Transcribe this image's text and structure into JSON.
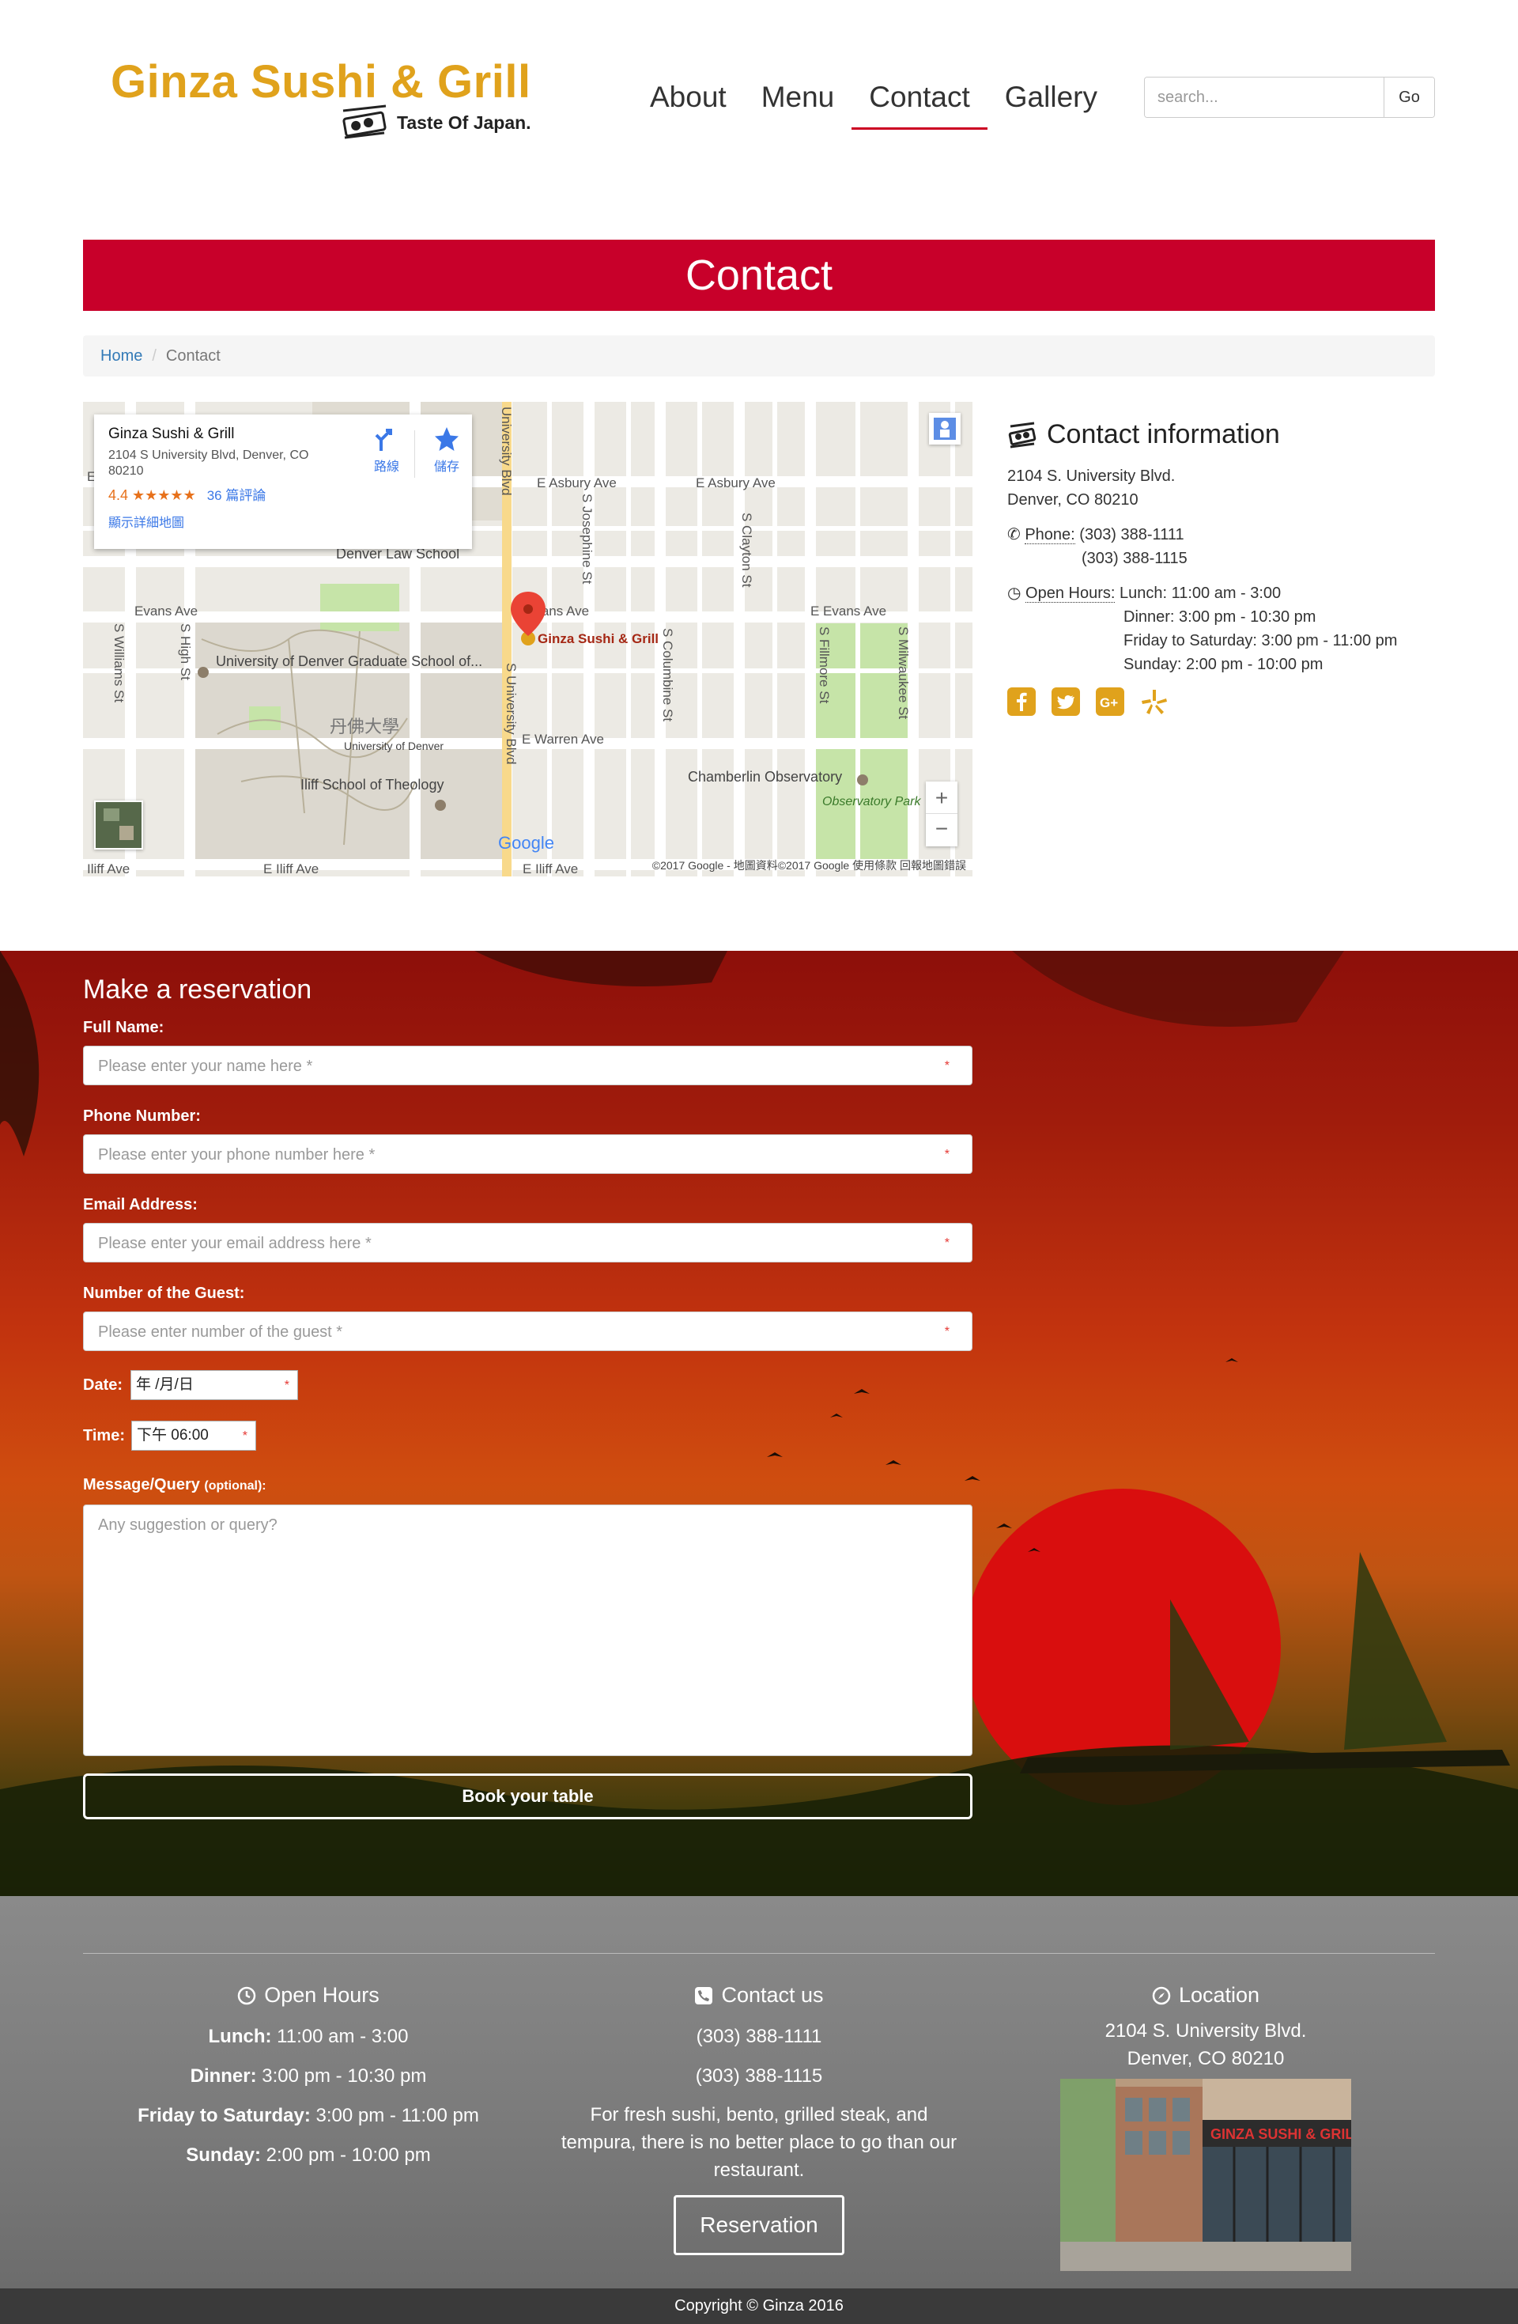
{
  "logo": {
    "title": "Ginza Sushi & Grill",
    "tagline": "Taste Of Japan."
  },
  "nav": [
    {
      "label": "About",
      "active": false
    },
    {
      "label": "Menu",
      "active": false
    },
    {
      "label": "Contact",
      "active": true
    },
    {
      "label": "Gallery",
      "active": false
    }
  ],
  "search": {
    "placeholder": "search...",
    "button": "Go"
  },
  "page_title": "Contact",
  "breadcrumb": {
    "home": "Home",
    "current": "Contact"
  },
  "map": {
    "card_name": "Ginza Sushi & Grill",
    "card_address": "2104 S University Blvd, Denver, CO 80210",
    "rating": "4.4 ★★★★★",
    "reviews": "36 篇評論",
    "more_link": "顯示詳細地圖",
    "directions": "路線",
    "save": "儲存",
    "pin_label": "Ginza Sushi & Grill",
    "streets": {
      "asbury_1": "E Asbury Ave",
      "asbury_2": "E Asbury Ave",
      "evans_1": "Evans Ave",
      "evans_2": "Evans Ave",
      "evans_3": "E Evans Ave",
      "warren": "E Warren Ave",
      "iliff_1": "Iliff Ave",
      "iliff_2": "E Iliff Ave",
      "iliff_3": "E Iliff Ave",
      "university": "S University Blvd",
      "university_top": "University Blvd",
      "josephine": "S Josephine St",
      "clayton": "S Clayton St",
      "columbine": "S Columbine St",
      "fillmore": "S Fillmore St",
      "milwaukee": "S Milwaukee St",
      "williams": "S Williams St",
      "high": "S High St"
    },
    "places": {
      "law_school": "Denver Law School",
      "grad_school": "University of Denver Graduate School of...",
      "du_chinese": "丹佛大學",
      "du": "University of Denver",
      "iliff": "Iliff School of Theology",
      "observatory": "Chamberlin Observatory",
      "park": "Observatory Park"
    },
    "google": "Google",
    "footer": "©2017 Google - 地圖資料©2017 Google   使用條款   回報地圖錯誤"
  },
  "contact_info": {
    "heading": "Contact information",
    "address_line1": "2104 S. University Blvd.",
    "address_line2": "Denver, CO 80210",
    "phone_label": "Phone:",
    "phone1": "(303) 388-1111",
    "phone2": "(303) 388-1115",
    "hours_label": "Open Hours:",
    "hours": [
      "Lunch: 11:00 am - 3:00",
      "Dinner: 3:00 pm - 10:30 pm",
      "Friday to Saturday: 3:00 pm - 11:00 pm",
      "Sunday: 2:00 pm - 10:00 pm"
    ],
    "social": [
      "facebook-icon",
      "twitter-icon",
      "google-plus-icon",
      "yelp-icon"
    ],
    "social_color": "#e0a21c"
  },
  "reservation": {
    "heading": "Make a reservation",
    "full_name_label": "Full Name:",
    "full_name_placeholder": "Please enter your name here *",
    "phone_label": "Phone Number:",
    "phone_placeholder": "Please enter your phone number here *",
    "email_label": "Email Address:",
    "email_placeholder": "Please enter your email address here *",
    "guests_label": "Number of the Guest:",
    "guests_placeholder": "Please enter number of the guest *",
    "date_label": "Date:",
    "date_value": "年 /月/日",
    "time_label": "Time:",
    "time_value": "下午 06:00",
    "message_label": "Message/Query",
    "message_optional": "(optional):",
    "message_placeholder": "Any suggestion or query?",
    "required_mark": "*",
    "submit": "Book your table"
  },
  "footer": {
    "hours_heading": "Open Hours",
    "hours": [
      {
        "label": "Lunch:",
        "value": " 11:00 am - 3:00"
      },
      {
        "label": "Dinner:",
        "value": " 3:00 pm - 10:30 pm"
      },
      {
        "label": "Friday to Saturday:",
        "value": " 3:00 pm - 11:00 pm"
      },
      {
        "label": "Sunday:",
        "value": " 2:00 pm - 10:00 pm"
      }
    ],
    "contact_heading": "Contact us",
    "phone1": "(303) 388-1111",
    "phone2": "(303) 388-1115",
    "description": "For fresh sushi, bento, grilled steak, and tempura, there is no better place to go than our restaurant.",
    "reservation_button": "Reservation",
    "location_heading": "Location",
    "address_line1": "2104 S. University Blvd.",
    "address_line2": "Denver, CO 80210",
    "photo_sign": "GINZA SUSHI & GRILL"
  },
  "copyright": "Copyright © Ginza 2016",
  "colors": {
    "brand": "#e0a21c",
    "accent_red": "#c8002a",
    "link": "#337ab7",
    "map_blue": "#3b78e7"
  }
}
